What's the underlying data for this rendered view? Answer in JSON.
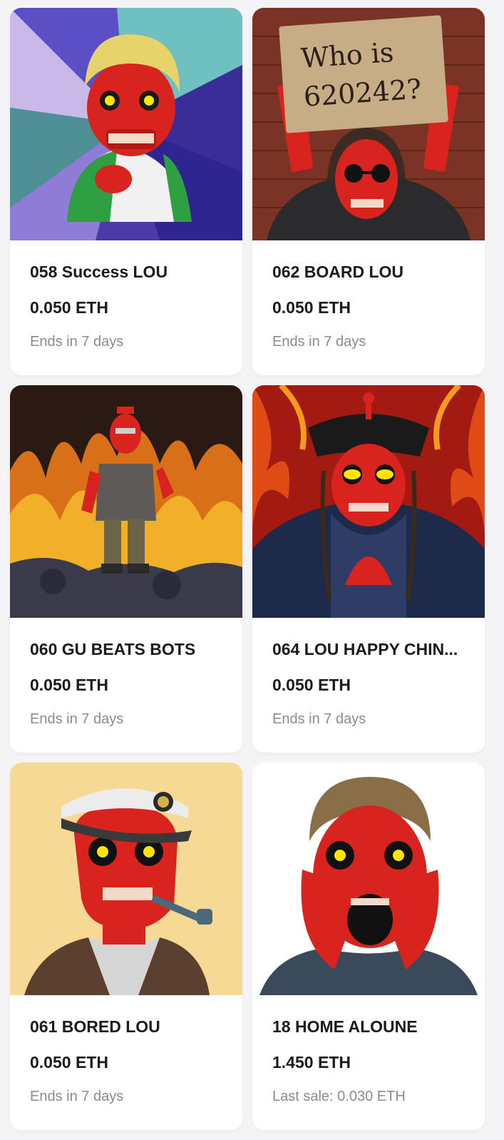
{
  "listings": [
    {
      "title": "058 Success LOU",
      "price": "0.050 ETH",
      "status": "Ends in 7 days",
      "image": "red-skull-blond-hair-green-jacket-art",
      "bg_color": "#5b3fb5"
    },
    {
      "title": "062 BOARD LOU",
      "price": "0.050 ETH",
      "status": "Ends in 7 days",
      "image": "red-skull-holding-sign-art",
      "sign_text_line1": "Who is",
      "sign_text_line2": "620242?",
      "bg_color": "#7a3324"
    },
    {
      "title": "060 GU BEATS BOTS",
      "price": "0.050 ETH",
      "status": "Ends in 7 days",
      "image": "red-skull-walking-through-fire-art",
      "bg_color": "#e08a1c"
    },
    {
      "title": "064 LOU HAPPY CHIN...",
      "price": "0.050 ETH",
      "status": "Ends in 7 days",
      "image": "red-skull-black-hat-praying-art",
      "bg_color": "#a31a12"
    },
    {
      "title": "061 BORED LOU",
      "price": "0.050 ETH",
      "status": "Ends in 7 days",
      "image": "red-skull-captain-hat-pipe-art",
      "bg_color": "#f6d995"
    },
    {
      "title": "18 HOME ALOUNE",
      "price": "1.450 ETH",
      "status_label": "Last sale:",
      "status_value": "0.030 ETH",
      "image": "red-skull-home-alone-scream-art",
      "bg_color": "#ffffff"
    }
  ],
  "colors": {
    "page_bg": "#f4f4f6",
    "card_bg": "#ffffff",
    "text_primary": "#1a1a1f",
    "text_secondary": "#8a8a94",
    "skull_red": "#d8231e"
  }
}
